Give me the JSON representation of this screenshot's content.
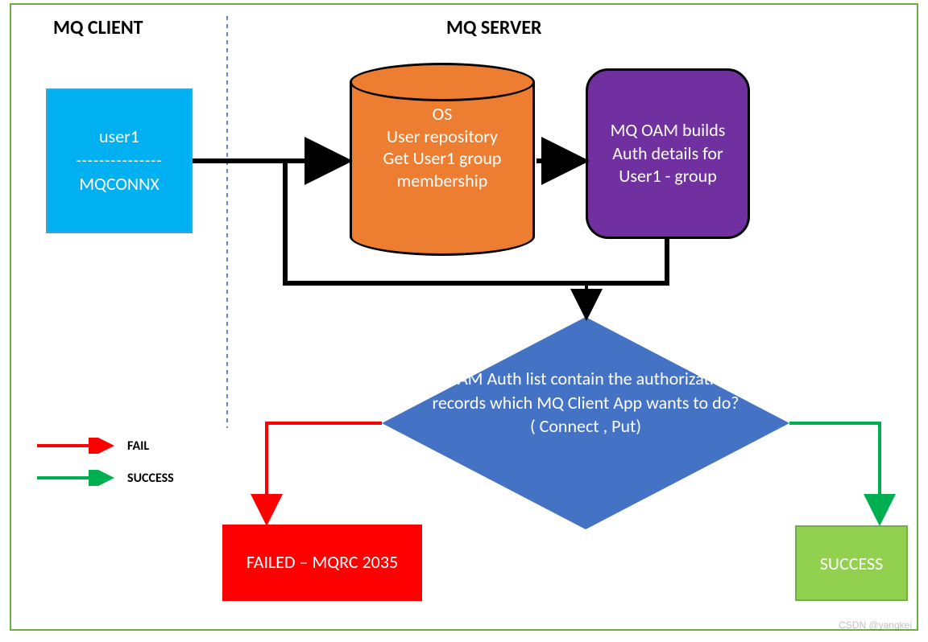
{
  "headers": {
    "client": "MQ CLIENT",
    "server": "MQ SERVER"
  },
  "client_box": {
    "line1": "user1",
    "divider": "---------------",
    "line2": "MQCONNX"
  },
  "cylinder": {
    "text": "OS\nUser repository\nGet User1 group membership"
  },
  "oam_box": {
    "text": "MQ OAM builds Auth details for User1 - group"
  },
  "decision": {
    "text": "If OAM Auth list contain the authorizations  records which  MQ Client App  wants to do?( Connect , Put)"
  },
  "fail_box": {
    "text": "FAILED – MQRC 2035"
  },
  "success_box": {
    "text": "SUCCESS"
  },
  "legend": {
    "fail": "FAIL",
    "success": "SUCCESS"
  },
  "colors": {
    "client": "#00b0f0",
    "cylinder": "#ed7d31",
    "oam": "#7030a0",
    "decision": "#4472c4",
    "fail": "#ff0000",
    "success_box": "#92d050",
    "success_arrow": "#00b050",
    "connector": "#000000",
    "border": "#6fac46"
  },
  "watermark": "CSDN @yangkei"
}
